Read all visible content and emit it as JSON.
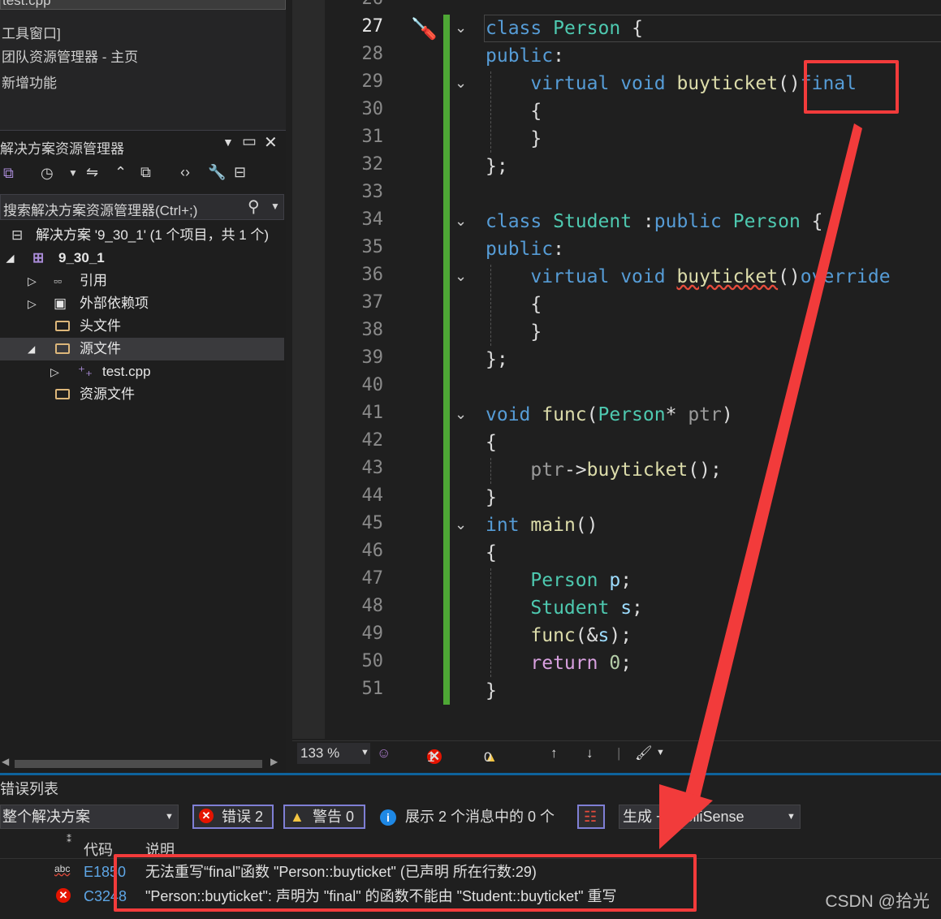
{
  "left": {
    "file_tab": "test.cpp",
    "menu_items": [
      "工具窗口]",
      "团队资源管理器 - 主页",
      "新增功能"
    ],
    "solution_explorer": {
      "title": "解决方案资源管理器",
      "search_placeholder": "搜索解决方案资源管理器(Ctrl+;)",
      "tree": [
        {
          "label": "解决方案 '9_30_1' (1 个项目，共 1 个)"
        },
        {
          "label": "9_30_1"
        },
        {
          "label": "引用"
        },
        {
          "label": "外部依赖项"
        },
        {
          "label": "头文件"
        },
        {
          "label": "源文件"
        },
        {
          "label": "test.cpp"
        },
        {
          "label": "资源文件"
        }
      ]
    }
  },
  "editor": {
    "first_line_partial": "26",
    "line_numbers": [
      "27",
      "28",
      "29",
      "30",
      "31",
      "32",
      "33",
      "34",
      "35",
      "36",
      "37",
      "38",
      "39",
      "40",
      "41",
      "42",
      "43",
      "44",
      "45",
      "46",
      "47",
      "48",
      "49",
      "50",
      "51"
    ],
    "current_line": "27"
  },
  "statusbar": {
    "zoom": "133 %",
    "errors": "1",
    "warnings": "0"
  },
  "error_list": {
    "title": "错误列表",
    "scope": "整个解决方案",
    "errors_btn": "错误 2",
    "warnings_btn": "警告 0",
    "messages": "展示 2 个消息中的 0 个",
    "build_filter": "生成 + IntelliSense",
    "col_code": "代码",
    "col_desc": "说明",
    "rows": [
      {
        "code": "E1850",
        "desc": "无法重写“final”函数 \"Person::buyticket\" (已声明 所在行数:29)"
      },
      {
        "code": "C3248",
        "desc": "\"Person::buyticket\": 声明为 \"final\" 的函数不能由 \"Student::buyticket\" 重写"
      }
    ]
  },
  "watermark": "CSDN @拾光",
  "colors": {
    "annotation": "#f23b3b",
    "change_bar": "#4ea735",
    "accent": "#0e639c"
  }
}
